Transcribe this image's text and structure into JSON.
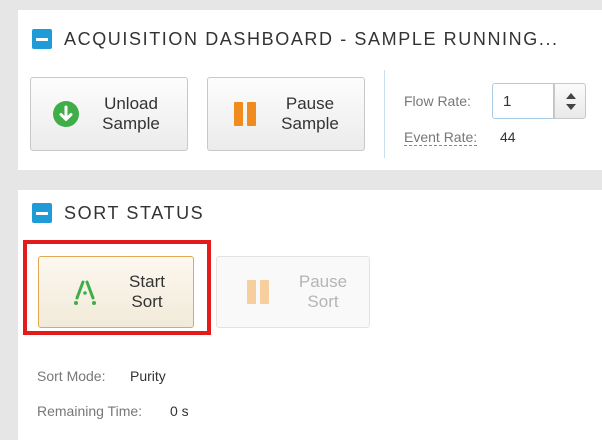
{
  "acquisition_panel": {
    "title": "ACQUISITION DASHBOARD - SAMPLE RUNNING...",
    "unload_button": {
      "label": "Unload\nSample",
      "icon": "arrow-down-circle-icon",
      "icon_color": "#3fae49"
    },
    "pause_button": {
      "label": "Pause\nSample",
      "icon": "pause-icon",
      "icon_color": "#f08c1e"
    },
    "flow_rate": {
      "label": "Flow Rate:",
      "value": "1"
    },
    "event_rate": {
      "label": "Event Rate:",
      "value": "44"
    }
  },
  "sort_panel": {
    "title": "SORT STATUS",
    "start_sort_button": {
      "label": "Start\nSort",
      "icon": "sort-streams-icon",
      "icon_color": "#3fae49"
    },
    "pause_sort_button": {
      "label": "Pause\nSort",
      "icon": "pause-icon",
      "state": "disabled"
    },
    "sort_mode": {
      "label": "Sort Mode:",
      "value": "Purity"
    },
    "remaining_time": {
      "label": "Remaining Time:",
      "value": "0 s"
    }
  },
  "colors": {
    "accent": "#1f9bd7",
    "highlight": "#e31b1b",
    "pause_orange": "#f08c1e",
    "go_green": "#3fae49"
  }
}
